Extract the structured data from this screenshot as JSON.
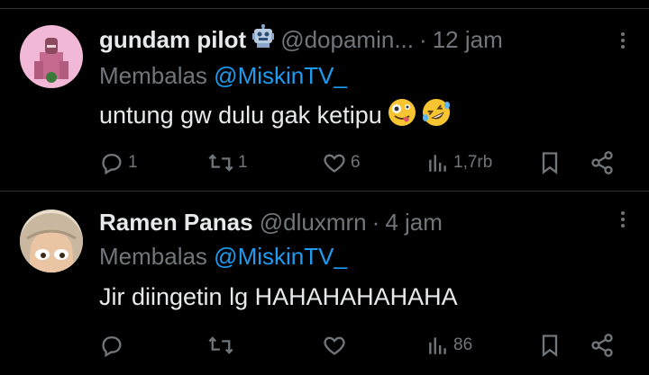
{
  "tweets": [
    {
      "name": "gundam pilot",
      "handle": "@dopamin...",
      "time": "12 jam",
      "reply_label": "Membalas",
      "reply_mention": "@MiskinTV_",
      "text": "untung gw dulu gak ketipu",
      "replies": "1",
      "retweets": "1",
      "likes": "6",
      "views": "1,7rb",
      "colors": {
        "avatar_bg": "#f2b8d8",
        "accent": "#1d9bf0"
      }
    },
    {
      "name": "Ramen Panas",
      "handle": "@dluxmrn",
      "time": "4 jam",
      "reply_label": "Membalas",
      "reply_mention": "@MiskinTV_",
      "text": "Jir diingetin lg HAHAHAHAHAHA",
      "replies": "",
      "retweets": "",
      "likes": "",
      "views": "86",
      "colors": {
        "avatar_bg": "#e8dccb",
        "accent": "#1d9bf0"
      }
    }
  ],
  "separator": "·",
  "icons": {
    "badge": "robot-icon",
    "emojis": [
      "zany-face-emoji",
      "rolling-laughing-emoji"
    ],
    "actions": [
      "reply-icon",
      "retweet-icon",
      "like-icon",
      "views-icon",
      "bookmark-icon",
      "share-icon"
    ],
    "menu": "more-options-icon"
  }
}
